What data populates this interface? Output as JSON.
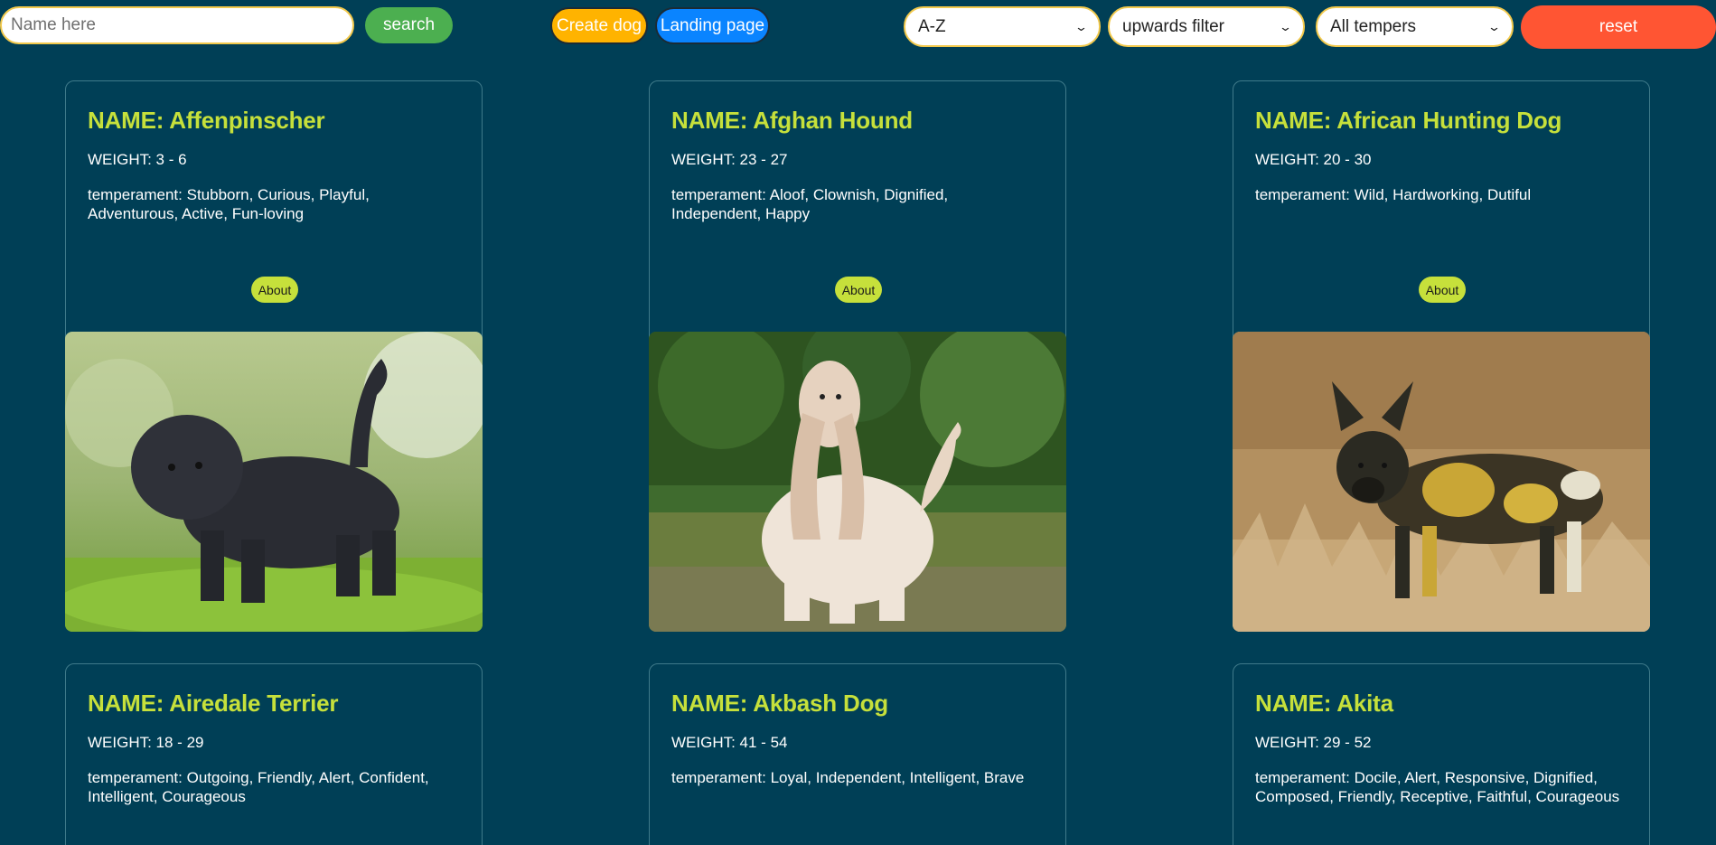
{
  "toolbar": {
    "search_placeholder": "Name here",
    "search_label": "search",
    "create_label": "Create dog",
    "landing_label": "Landing page",
    "order_select": "A-Z",
    "weight_select": "upwards filter",
    "temper_select": "All tempers",
    "reset_label": "reset"
  },
  "about_label": "About",
  "dogs": [
    {
      "name": "NAME: Affenpinscher",
      "weight": "WEIGHT: 3 - 6",
      "temperament": "temperament: Stubborn, Curious, Playful, Adventurous, Active, Fun-loving"
    },
    {
      "name": "NAME: Afghan Hound",
      "weight": "WEIGHT: 23 - 27",
      "temperament": "temperament: Aloof, Clownish, Dignified, Independent, Happy"
    },
    {
      "name": "NAME: African Hunting Dog",
      "weight": "WEIGHT: 20 - 30",
      "temperament": "temperament: Wild, Hardworking, Dutiful"
    },
    {
      "name": "NAME: Airedale Terrier",
      "weight": "WEIGHT: 18 - 29",
      "temperament": "temperament: Outgoing, Friendly, Alert, Confident, Intelligent, Courageous"
    },
    {
      "name": "NAME: Akbash Dog",
      "weight": "WEIGHT: 41 - 54",
      "temperament": "temperament: Loyal, Independent, Intelligent, Brave"
    },
    {
      "name": "NAME: Akita",
      "weight": "WEIGHT: 29 - 52",
      "temperament": "temperament: Docile, Alert, Responsive, Dignified, Composed, Friendly, Receptive, Faithful, Courageous"
    }
  ]
}
